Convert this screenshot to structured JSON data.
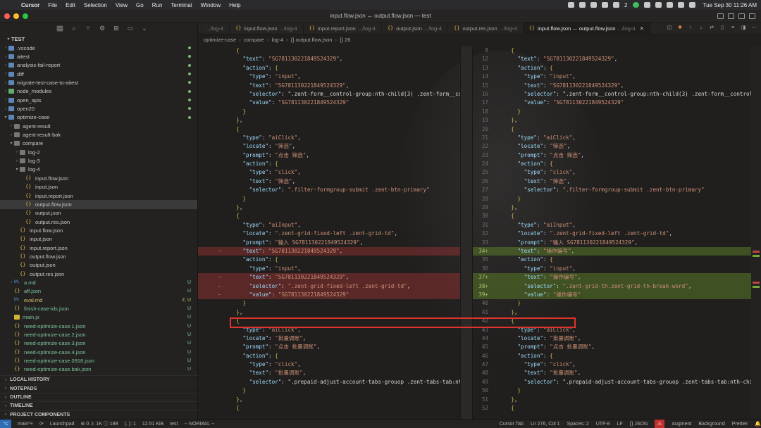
{
  "menubar": {
    "app": "Cursor",
    "items": [
      "File",
      "Edit",
      "Selection",
      "View",
      "Go",
      "Run",
      "Terminal",
      "Window",
      "Help"
    ],
    "notification_count": "2",
    "clock": "Tue Sep 30  11:26 AM"
  },
  "window": {
    "title": "input.flow.json ↔ output.flow.json — test"
  },
  "sidebar": {
    "root": "TEST",
    "tree": [
      {
        "name": ".vscode",
        "kind": "folder",
        "depth": 1,
        "collapsed": true,
        "badge": "dot"
      },
      {
        "name": "aitest",
        "kind": "folder",
        "depth": 1,
        "collapsed": true,
        "badge": "dot"
      },
      {
        "name": "analysis-fail-report",
        "kind": "folder",
        "depth": 1,
        "collapsed": true,
        "badge": "dot"
      },
      {
        "name": "diff",
        "kind": "folder",
        "depth": 1,
        "collapsed": true,
        "badge": "dot"
      },
      {
        "name": "migrate-test-case-to-aitest",
        "kind": "folder",
        "depth": 1,
        "collapsed": true,
        "badge": "dot"
      },
      {
        "name": "node_modules",
        "kind": "folder-green",
        "depth": 1,
        "collapsed": true,
        "badge": "dot"
      },
      {
        "name": "open_apis",
        "kind": "folder",
        "depth": 1,
        "collapsed": true,
        "badge": "dot"
      },
      {
        "name": "open20",
        "kind": "folder",
        "depth": 1,
        "collapsed": true,
        "badge": "dot"
      },
      {
        "name": "optimize-case",
        "kind": "folder",
        "depth": 1,
        "collapsed": false,
        "badge": "dot"
      },
      {
        "name": "agent-result",
        "kind": "folder-plain",
        "depth": 2,
        "collapsed": true
      },
      {
        "name": "agent-result-bak",
        "kind": "folder-plain",
        "depth": 2,
        "collapsed": true
      },
      {
        "name": "compare",
        "kind": "folder-plain",
        "depth": 2,
        "collapsed": false
      },
      {
        "name": "log-2",
        "kind": "folder-plain",
        "depth": 3,
        "collapsed": true
      },
      {
        "name": "log-3",
        "kind": "folder-plain",
        "depth": 3,
        "collapsed": true
      },
      {
        "name": "log-4",
        "kind": "folder-plain",
        "depth": 3,
        "collapsed": false
      },
      {
        "name": "input.flow.json",
        "kind": "json",
        "depth": 4
      },
      {
        "name": "input.json",
        "kind": "json",
        "depth": 4
      },
      {
        "name": "input.report.json",
        "kind": "json",
        "depth": 4
      },
      {
        "name": "output.flow.json",
        "kind": "json",
        "depth": 4,
        "selected": true
      },
      {
        "name": "output.json",
        "kind": "json",
        "depth": 4
      },
      {
        "name": "output.res.json",
        "kind": "json",
        "depth": 4
      },
      {
        "name": "input.flow.json",
        "kind": "json",
        "depth": 3
      },
      {
        "name": "input.json",
        "kind": "json",
        "depth": 3
      },
      {
        "name": "input.report.json",
        "kind": "json",
        "depth": 3
      },
      {
        "name": "output.flow.json",
        "kind": "json",
        "depth": 3
      },
      {
        "name": "output.json",
        "kind": "json",
        "depth": 3
      },
      {
        "name": "output.res.json",
        "kind": "json",
        "depth": 3
      },
      {
        "name": "a.md",
        "kind": "md",
        "depth": 2,
        "collapsed": true,
        "badge": "U",
        "color": "green"
      },
      {
        "name": "aff.json",
        "kind": "json",
        "depth": 2,
        "badge": "U",
        "color": "green"
      },
      {
        "name": "eval.md",
        "kind": "md",
        "depth": 2,
        "badge": "2, U",
        "color": "yellow"
      },
      {
        "name": "finish-case-ids.json",
        "kind": "json",
        "depth": 2,
        "badge": "U",
        "color": "green"
      },
      {
        "name": "main.js",
        "kind": "js",
        "depth": 2,
        "badge": "U",
        "color": "green"
      },
      {
        "name": "need-optimize-case.1.json",
        "kind": "json",
        "depth": 2,
        "badge": "U",
        "color": "green"
      },
      {
        "name": "need-optimize-case.2.json",
        "kind": "json",
        "depth": 2,
        "badge": "U",
        "color": "green"
      },
      {
        "name": "need-optimize-case.3.json",
        "kind": "json",
        "depth": 2,
        "badge": "U",
        "color": "green"
      },
      {
        "name": "need-optimize-case.4.json",
        "kind": "json",
        "depth": 2,
        "badge": "U",
        "color": "green"
      },
      {
        "name": "need-optimize-case.0918.json",
        "kind": "json",
        "depth": 2,
        "badge": "U",
        "color": "green"
      },
      {
        "name": "need-optimize-case.bak.json",
        "kind": "json",
        "depth": 2,
        "badge": "U",
        "color": "green"
      }
    ],
    "sections": [
      "LOCAL HISTORY",
      "NOTEPADS",
      "OUTLINE",
      "TIMELINE",
      "PROJECT COMPONENTS"
    ]
  },
  "tabs": [
    {
      "name": "",
      "path": ".../log-4",
      "active": false
    },
    {
      "name": "input.flow.json",
      "path": ".../log-4",
      "active": false
    },
    {
      "name": "input.report.json",
      "path": ".../log-4",
      "active": false
    },
    {
      "name": "output.json",
      "path": ".../log-4",
      "active": false
    },
    {
      "name": "output.res.json",
      "path": ".../log-4",
      "active": false
    },
    {
      "name": "input.flow.json ↔ output.flow.json",
      "path": ".../log-4",
      "active": true
    }
  ],
  "breadcrumb": [
    "optimize-case",
    "compare",
    "log-4",
    "{} output.flow.json",
    "{} 26"
  ],
  "diff": {
    "left": [
      {
        "n": "",
        "t": "    {"
      },
      {
        "n": "",
        "t": "      \"text\": \"SG781130221849524329\","
      },
      {
        "n": "",
        "t": "      \"action\": {"
      },
      {
        "n": "",
        "t": "        \"type\": \"input\","
      },
      {
        "n": "",
        "t": "        \"text\": \"SG781130221849524329\","
      },
      {
        "n": "",
        "t": "        \"selector\": \".zent-form__control-group:nth-child(3) .zent-form__cont"
      },
      {
        "n": "",
        "t": "        \"value\": \"SG781130221849524329\""
      },
      {
        "n": "",
        "t": "      }"
      },
      {
        "n": "",
        "t": "    },"
      },
      {
        "n": "",
        "t": "    {"
      },
      {
        "n": "",
        "t": "      \"type\": \"aiClick\","
      },
      {
        "n": "",
        "t": "      \"locate\": \"筛选\","
      },
      {
        "n": "",
        "t": "      \"prompt\": \"点击 筛选\","
      },
      {
        "n": "",
        "t": "      \"action\": {"
      },
      {
        "n": "",
        "t": "        \"type\": \"click\","
      },
      {
        "n": "",
        "t": "        \"text\": \"筛选\","
      },
      {
        "n": "",
        "t": "        \"selector\": \".filter-formgroup-submit .zent-btn-primary\""
      },
      {
        "n": "",
        "t": "      }"
      },
      {
        "n": "",
        "t": "    },"
      },
      {
        "n": "",
        "t": "    {"
      },
      {
        "n": "",
        "t": "      \"type\": \"aiInput\","
      },
      {
        "n": "",
        "t": "      \"locate\": \".zent-grid-fixed-left .zent-grid-td\","
      },
      {
        "n": "",
        "t": "      \"prompt\": \"输入 SG781130221849524329\","
      },
      {
        "n": "",
        "t": "      \"text\": \"SG781130221849524329\",",
        "cls": "del"
      },
      {
        "n": "",
        "t": "      \"action\": {"
      },
      {
        "n": "",
        "t": "        \"type\": \"input\","
      },
      {
        "n": "",
        "t": "        \"text\": \"SG781130221849524329\",",
        "cls": "del"
      },
      {
        "n": "",
        "t": "        \"selector\": \".zent-grid-fixed-left .zent-grid-td\",",
        "cls": "del"
      },
      {
        "n": "",
        "t": "        \"value\": \"SG781130221849524329\"",
        "cls": "del"
      },
      {
        "n": "",
        "t": "      }"
      },
      {
        "n": "",
        "t": "    },"
      },
      {
        "n": "",
        "t": "    {"
      },
      {
        "n": "",
        "t": "      \"type\": \"aiClick\","
      },
      {
        "n": "",
        "t": "      \"locate\": \"批量调账\","
      },
      {
        "n": "",
        "t": "      \"prompt\": \"点击 批量调账\","
      },
      {
        "n": "",
        "t": "      \"action\": {"
      },
      {
        "n": "",
        "t": "        \"type\": \"click\","
      },
      {
        "n": "",
        "t": "        \"text\": \"批量调账\","
      },
      {
        "n": "",
        "t": "        \"selector\": \".prepaid-adjust-account-tabs-grouop .zent-tabs-tab:nth-"
      },
      {
        "n": "",
        "t": "      }"
      },
      {
        "n": "",
        "t": "    },"
      },
      {
        "n": "",
        "t": "    {"
      }
    ],
    "right": [
      {
        "n": "8",
        "t": "    {"
      },
      {
        "n": "12",
        "t": "      \"text\": \"SG781130221849524329\","
      },
      {
        "n": "13",
        "t": "      \"action\": {"
      },
      {
        "n": "14",
        "t": "        \"type\": \"input\","
      },
      {
        "n": "15",
        "t": "        \"text\": \"SG781130221849524329\","
      },
      {
        "n": "16",
        "t": "        \"selector\": \".zent-form__control-group:nth-child(3) .zent-form__controls"
      },
      {
        "n": "17",
        "t": "        \"value\": \"SG781130221849524329\""
      },
      {
        "n": "18",
        "t": "      }"
      },
      {
        "n": "19",
        "t": "    },"
      },
      {
        "n": "20",
        "t": "    {"
      },
      {
        "n": "21",
        "t": "      \"type\": \"aiClick\","
      },
      {
        "n": "22",
        "t": "      \"locate\": \"筛选\","
      },
      {
        "n": "23",
        "t": "      \"prompt\": \"点击 筛选\","
      },
      {
        "n": "24",
        "t": "      \"action\": {"
      },
      {
        "n": "25",
        "t": "        \"type\": \"click\","
      },
      {
        "n": "26",
        "t": "        \"text\": \"筛选\","
      },
      {
        "n": "27",
        "t": "        \"selector\": \".filter-formgroup-submit .zent-btn-primary\""
      },
      {
        "n": "28",
        "t": "      }"
      },
      {
        "n": "29",
        "t": "    },"
      },
      {
        "n": "30",
        "t": "    {"
      },
      {
        "n": "31",
        "t": "      \"type\": \"aiInput\","
      },
      {
        "n": "32",
        "t": "      \"locate\": \".zent-grid-fixed-left .zent-grid-td\","
      },
      {
        "n": "33",
        "t": "      \"prompt\": \"输入 SG781130221849524329\","
      },
      {
        "n": "34+",
        "t": "      \"text\": \"操作编号\",",
        "cls": "add"
      },
      {
        "n": "35",
        "t": "      \"action\": {"
      },
      {
        "n": "36",
        "t": "        \"type\": \"input\","
      },
      {
        "n": "37+",
        "t": "        \"text\": \"操作编号\",",
        "cls": "add"
      },
      {
        "n": "38+",
        "t": "        \"selector\": \".zent-grid-th.zent-grid-th-break-word\",",
        "cls": "add"
      },
      {
        "n": "39+",
        "t": "        \"value\": \"操作编号\"",
        "cls": "add"
      },
      {
        "n": "40",
        "t": "      }"
      },
      {
        "n": "41",
        "t": "    },"
      },
      {
        "n": "42",
        "t": "    {"
      },
      {
        "n": "43",
        "t": "      \"type\": \"aiClick\","
      },
      {
        "n": "44",
        "t": "      \"locate\": \"批量调账\","
      },
      {
        "n": "45",
        "t": "      \"prompt\": \"点击 批量调账\","
      },
      {
        "n": "46",
        "t": "      \"action\": {"
      },
      {
        "n": "47",
        "t": "        \"type\": \"click\","
      },
      {
        "n": "48",
        "t": "        \"text\": \"批量调账\","
      },
      {
        "n": "49",
        "t": "        \"selector\": \".prepaid-adjust-account-tabs-grouop .zent-tabs-tab:nth-chil"
      },
      {
        "n": "50",
        "t": "      }"
      },
      {
        "n": "51",
        "t": "    },"
      },
      {
        "n": "52",
        "t": "    {"
      }
    ]
  },
  "statusbar": {
    "branch": "main*+",
    "launchpad": "Launchpad",
    "problems": "⊗ 0  ⚠ 1K  ⓘ 189",
    "selection": "(..): 1",
    "size": "12.51 KiB",
    "folder": "test",
    "mode": "-- NORMAL --",
    "cursor_tab": "Cursor Tab",
    "position": "Ln 276, Col 1",
    "spaces": "Spaces: 2",
    "encoding": "UTF-8",
    "eol": "LF",
    "language": "{} JSON",
    "augment": "Augment",
    "background": "Background",
    "prettier": "Prettier"
  }
}
